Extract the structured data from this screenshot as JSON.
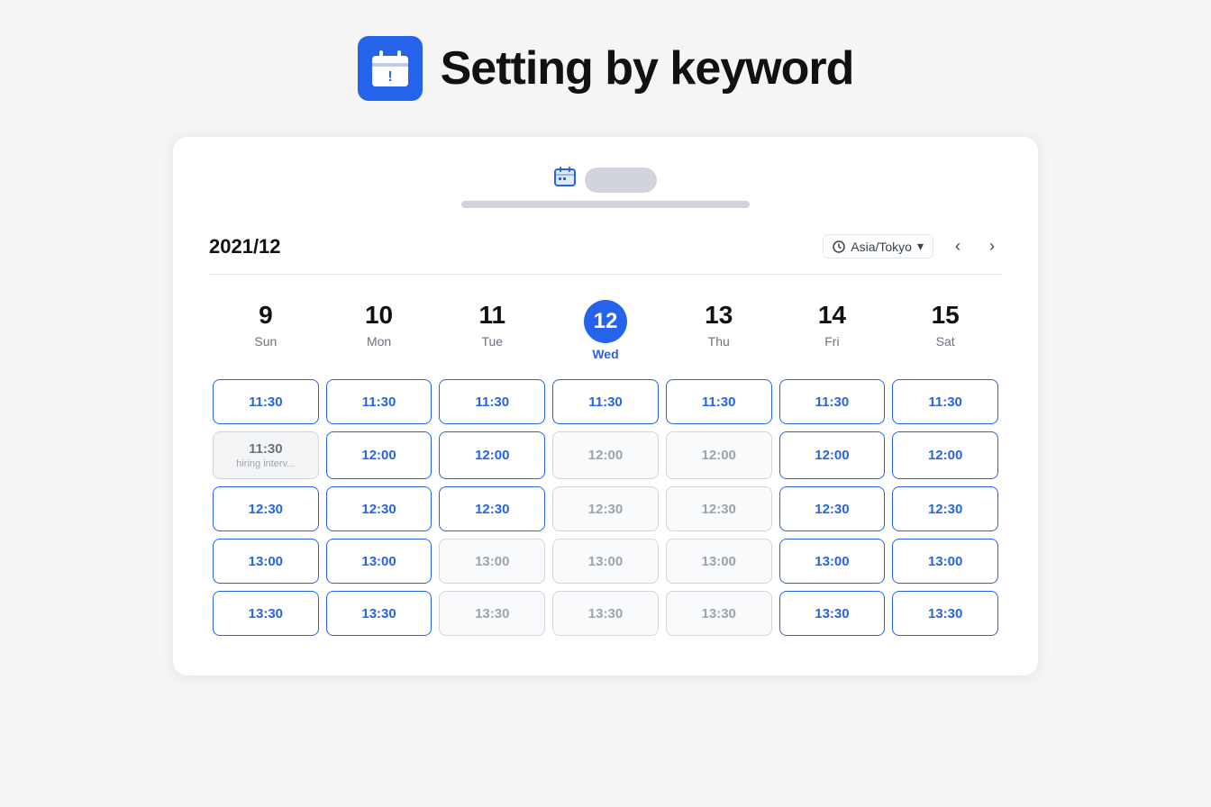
{
  "header": {
    "icon_label": "calendar-alert-icon",
    "title": "Setting by keyword"
  },
  "calendar": {
    "month": "2021/12",
    "timezone": "Asia/Tokyo",
    "days": [
      {
        "number": "9",
        "name": "Sun",
        "today": false
      },
      {
        "number": "10",
        "name": "Mon",
        "today": false
      },
      {
        "number": "11",
        "name": "Tue",
        "today": false
      },
      {
        "number": "12",
        "name": "Wed",
        "today": true
      },
      {
        "number": "13",
        "name": "Thu",
        "today": false
      },
      {
        "number": "14",
        "name": "Fri",
        "today": false
      },
      {
        "number": "15",
        "name": "Sat",
        "today": false
      }
    ],
    "slot_rows": [
      {
        "slots": [
          {
            "time": "11:30",
            "state": "available"
          },
          {
            "time": "11:30",
            "state": "available"
          },
          {
            "time": "11:30",
            "state": "available"
          },
          {
            "time": "11:30",
            "state": "available"
          },
          {
            "time": "11:30",
            "state": "available"
          },
          {
            "time": "11:30",
            "state": "available"
          },
          {
            "time": "11:30",
            "state": "available"
          }
        ]
      },
      {
        "slots": [
          {
            "time": "11:30",
            "state": "booked",
            "label": "hiring interv..."
          },
          {
            "time": "12:00",
            "state": "available"
          },
          {
            "time": "12:00",
            "state": "available"
          },
          {
            "time": "12:00",
            "state": "disabled"
          },
          {
            "time": "12:00",
            "state": "disabled"
          },
          {
            "time": "12:00",
            "state": "available"
          },
          {
            "time": "12:00",
            "state": "available"
          }
        ]
      },
      {
        "slots": [
          {
            "time": "12:30",
            "state": "available"
          },
          {
            "time": "12:30",
            "state": "available"
          },
          {
            "time": "12:30",
            "state": "available"
          },
          {
            "time": "12:30",
            "state": "disabled"
          },
          {
            "time": "12:30",
            "state": "disabled"
          },
          {
            "time": "12:30",
            "state": "available"
          },
          {
            "time": "12:30",
            "state": "available"
          }
        ]
      },
      {
        "slots": [
          {
            "time": "13:00",
            "state": "available"
          },
          {
            "time": "13:00",
            "state": "available"
          },
          {
            "time": "13:00",
            "state": "disabled"
          },
          {
            "time": "13:00",
            "state": "disabled"
          },
          {
            "time": "13:00",
            "state": "disabled"
          },
          {
            "time": "13:00",
            "state": "available"
          },
          {
            "time": "13:00",
            "state": "available"
          }
        ]
      },
      {
        "slots": [
          {
            "time": "13:30",
            "state": "available"
          },
          {
            "time": "13:30",
            "state": "available"
          },
          {
            "time": "13:30",
            "state": "disabled"
          },
          {
            "time": "13:30",
            "state": "disabled"
          },
          {
            "time": "13:30",
            "state": "disabled"
          },
          {
            "time": "13:30",
            "state": "available"
          },
          {
            "time": "13:30",
            "state": "available"
          }
        ]
      }
    ]
  },
  "nav": {
    "prev_label": "‹",
    "next_label": "›"
  }
}
